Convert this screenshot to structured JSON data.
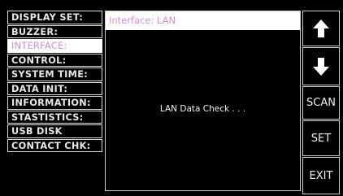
{
  "menu": {
    "items": [
      {
        "label": "DISPLAY SET:"
      },
      {
        "label": "BUZZER:"
      },
      {
        "label": "INTERFACE:"
      },
      {
        "label": "CONTROL:"
      },
      {
        "label": "SYSTEM TIME:"
      },
      {
        "label": "DATA INIT:"
      },
      {
        "label": "INFORMATION:"
      },
      {
        "label": "STASTISTICS:"
      },
      {
        "label": "USB DISK"
      },
      {
        "label": "CONTACT CHK:"
      }
    ],
    "selected_index": 2
  },
  "panel": {
    "header": "Interface: LAN",
    "message": "LAN Data Check . . ."
  },
  "softkeys": {
    "up_icon": "arrow-up-icon",
    "down_icon": "arrow-down-icon",
    "scan_label": "SCAN",
    "set_label": "SET",
    "exit_label": "EXIT"
  },
  "colors": {
    "background": "#000000",
    "highlight_text": "#d48fd1",
    "highlight_bg": "#ffffff",
    "text": "#e6e6e6"
  }
}
